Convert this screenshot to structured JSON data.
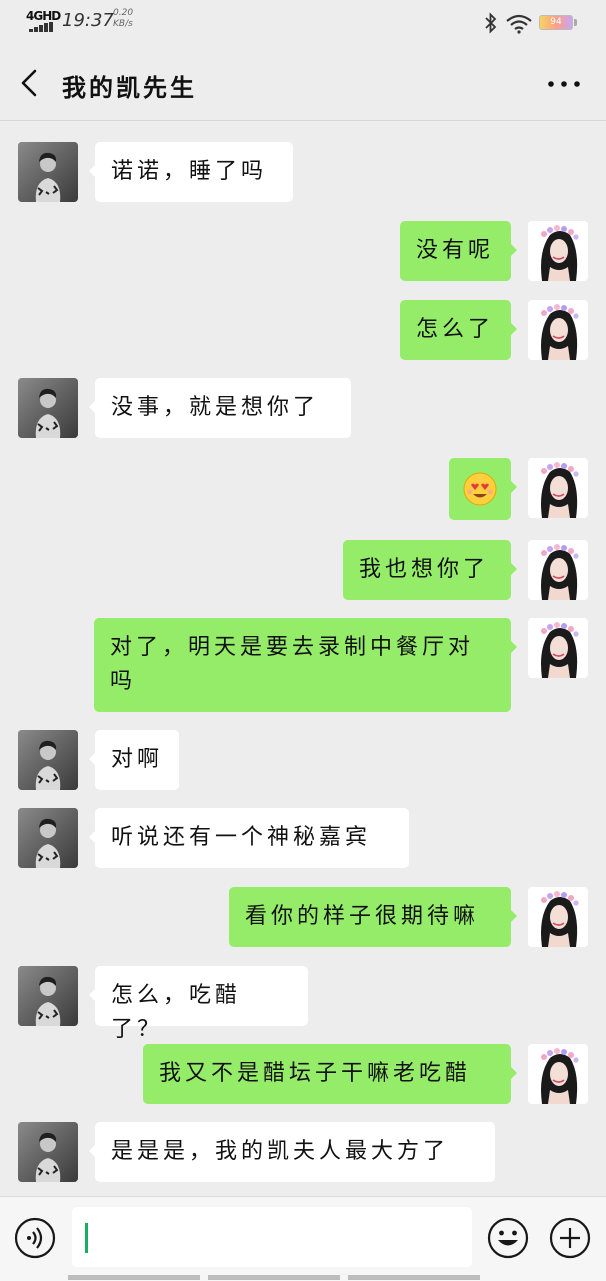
{
  "status_bar": {
    "network": "4GHD",
    "time": "19:37",
    "speed_value": "0.20",
    "speed_unit": "KB/s",
    "battery": "94",
    "icons": [
      "signal-icon",
      "bluetooth-icon",
      "wifi-icon",
      "battery-icon"
    ]
  },
  "nav": {
    "title": "我的凯先生",
    "back_icon": "chevron-left-icon",
    "more_icon": "ellipsis-icon"
  },
  "messages": [
    {
      "side": "left",
      "text": "诺诺，睡了吗"
    },
    {
      "side": "right",
      "text": "没有呢"
    },
    {
      "side": "right",
      "text": "怎么了"
    },
    {
      "side": "left",
      "text": "没事，就是想你了"
    },
    {
      "side": "right",
      "text": "",
      "emoji": "heart-eyes-emoji"
    },
    {
      "side": "right",
      "text": "我也想你了"
    },
    {
      "side": "right",
      "text": "对了，明天是要去录制中餐厅对吗"
    },
    {
      "side": "left",
      "text": "对啊"
    },
    {
      "side": "left",
      "text": "听说还有一个神秘嘉宾"
    },
    {
      "side": "right",
      "text": "看你的样子很期待嘛"
    },
    {
      "side": "left",
      "text": "怎么，吃醋了？"
    },
    {
      "side": "right",
      "text": "我又不是醋坛子干嘛老吃醋"
    },
    {
      "side": "left",
      "text": "是是是，我的凯夫人最大方了"
    }
  ],
  "input_bar": {
    "value": "",
    "icons": [
      "voice-icon",
      "emoji-icon",
      "add-icon"
    ]
  },
  "colors": {
    "background": "#ededed",
    "bubble_self": "#95ec69",
    "bubble_other": "#ffffff",
    "caret": "#19ad5f"
  }
}
